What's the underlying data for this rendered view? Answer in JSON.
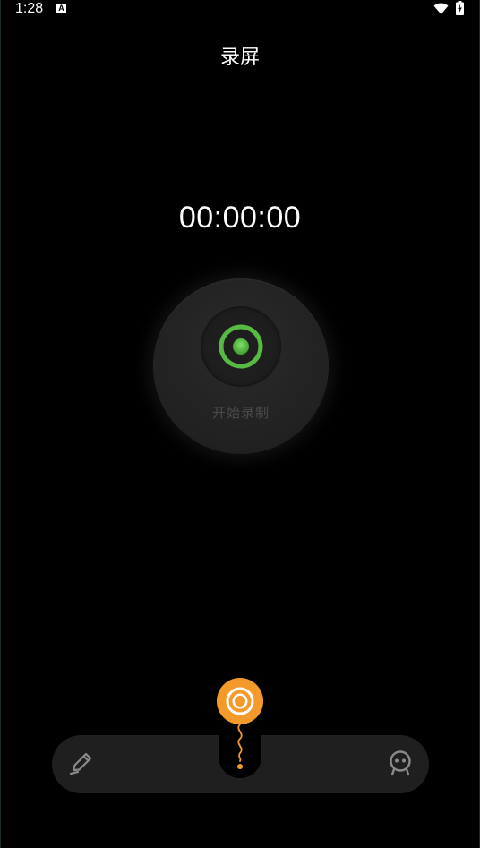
{
  "status_bar": {
    "time": "1:28",
    "notification_badge": "A"
  },
  "page": {
    "title": "录屏"
  },
  "timer": {
    "value": "00:00:00"
  },
  "record": {
    "label": "开始录制",
    "accent_color": "#5fc04a"
  },
  "toolbar": {
    "left_icon": "pen-icon",
    "right_icon": "face-icon",
    "floating_icon": "record-target-icon",
    "floating_color": "#f49a2a"
  }
}
